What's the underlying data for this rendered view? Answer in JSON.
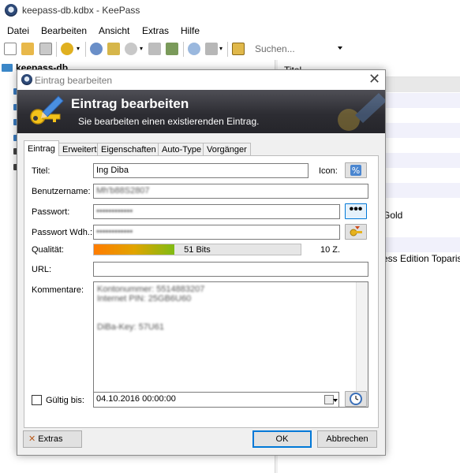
{
  "main_window": {
    "title": "keepass-db.kdbx - KeePass",
    "menu": [
      "Datei",
      "Bearbeiten",
      "Ansicht",
      "Extras",
      "Hilfe"
    ],
    "search_placeholder": "Suchen...",
    "tree_root": "keepass-db",
    "list_header": "Titel",
    "list_visible_fragments": [
      "Gold",
      "ess Edition Toparis"
    ]
  },
  "dialog": {
    "window_title": "Eintrag bearbeiten",
    "banner_title": "Eintrag bearbeiten",
    "banner_subtitle": "Sie bearbeiten einen existierenden Eintrag.",
    "tabs": [
      "Eintrag",
      "Erweitert",
      "Eigenschaften",
      "Auto-Type",
      "Vorgänger"
    ],
    "active_tab": "Eintrag",
    "fields": {
      "title_label": "Titel:",
      "title_value": "Ing Diba",
      "icon_label": "Icon:",
      "username_label": "Benutzername:",
      "username_value": "Mh'b88S2807",
      "password_label": "Passwort:",
      "password_value": "••••••••••••",
      "password_repeat_label": "Passwort Wdh.:",
      "password_repeat_value": "••••••••••••",
      "quality_label": "Qualität:",
      "quality_text": "51 Bits",
      "quality_fraction": 0.39,
      "quality_chars": "10 Z.",
      "url_label": "URL:",
      "url_value": "",
      "notes_label": "Kommentare:",
      "notes_lines": [
        "Kontonummer: 5514883207",
        "Internet PIN: 25GB6U60",
        "",
        "",
        "DiBa-Key: 57U61"
      ],
      "expiry_label": "Gültig bis:",
      "expiry_checked": false,
      "expiry_value": "04.10.2016 00:00:00"
    },
    "buttons": {
      "tools": "Extras",
      "ok": "OK",
      "cancel": "Abbrechen"
    }
  }
}
